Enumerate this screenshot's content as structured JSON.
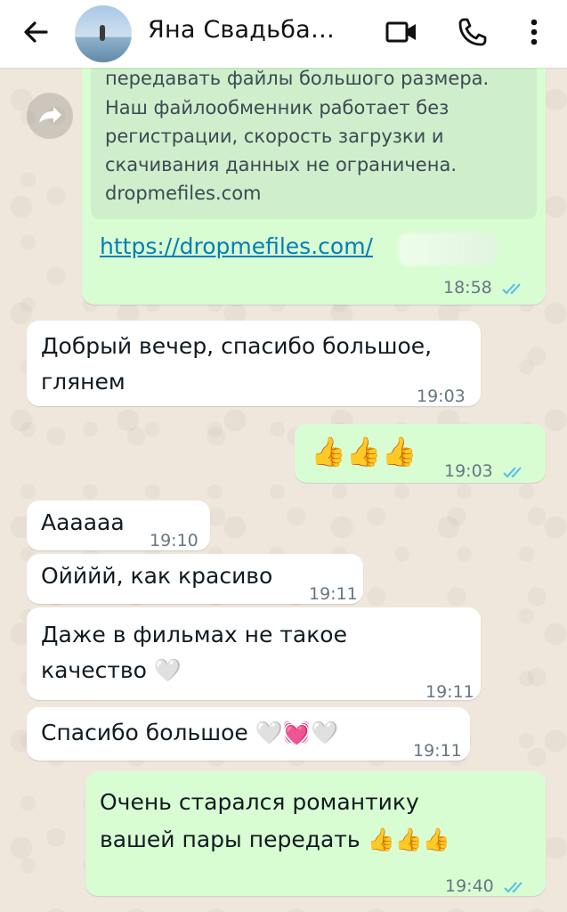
{
  "header": {
    "title": "Яна Свадьба…",
    "icons": [
      "back-arrow-icon",
      "video-call-icon",
      "phone-icon",
      "more-vert-icon"
    ]
  },
  "colors": {
    "outgoing": "#d9fdd3",
    "incoming": "#ffffff",
    "tick_read": "#53bdeb",
    "link": "#027eb5"
  },
  "messages": [
    {
      "direction": "out",
      "preview_lines": [
        "передавать файлы большого размера.",
        "Наш файлообменник работает без",
        "регистрации, скорость загрузки и",
        "скачивания данных не ограничена.",
        "dropmefiles.com"
      ],
      "link": "https://dropmefiles.com/",
      "time": "18:58",
      "status": "read"
    },
    {
      "direction": "in",
      "lines": [
        "Добрый вечер, спасибо большое,",
        "глянем"
      ],
      "time": "19:03"
    },
    {
      "direction": "out",
      "text": "👍👍👍",
      "time": "19:03",
      "status": "read"
    },
    {
      "direction": "in",
      "text": "Аааааа",
      "time": "19:10"
    },
    {
      "direction": "in",
      "text": "Ойййй, как красиво",
      "time": "19:11"
    },
    {
      "direction": "in",
      "lines": [
        "Даже в фильмах не такое",
        "качество 🤍"
      ],
      "time": "19:11"
    },
    {
      "direction": "in",
      "text": "Спасибо большое 🤍💓🤍",
      "time": "19:11"
    },
    {
      "direction": "out",
      "lines": [
        "Очень старался романтику",
        "вашей пары передать 👍👍👍"
      ],
      "time": "19:40",
      "status": "read"
    }
  ]
}
